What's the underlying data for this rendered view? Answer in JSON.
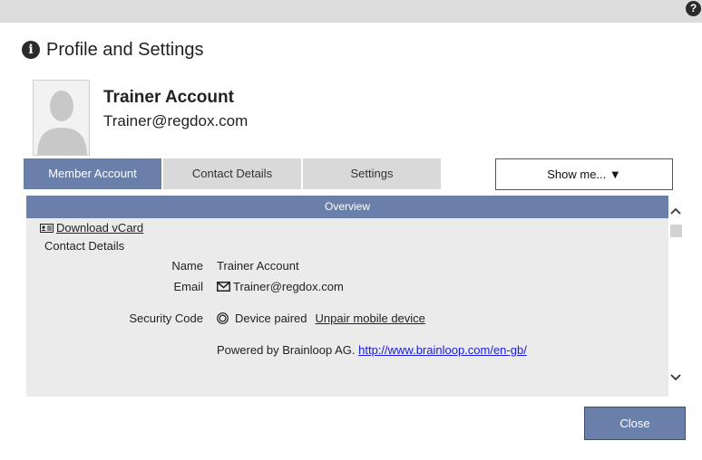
{
  "topbar": {
    "help_icon": "?"
  },
  "dialog": {
    "info_icon": "i",
    "title": "Profile and Settings",
    "account": {
      "name": "Trainer Account",
      "email": "Trainer@regdox.com"
    },
    "tabs": [
      {
        "label": "Member Account",
        "active": true
      },
      {
        "label": "Contact Details",
        "active": false
      },
      {
        "label": "Settings",
        "active": false
      }
    ],
    "show_me_label": "Show me... ▼",
    "panel": {
      "header": "Overview",
      "download_vcard": "Download vCard",
      "section_title": "Contact Details",
      "fields": [
        {
          "label": "Name",
          "value": "Trainer Account"
        },
        {
          "label": "Email",
          "value": "Trainer@regdox.com"
        },
        {
          "label": "Security Code",
          "value": "Device paired",
          "action": "Unpair mobile device"
        }
      ],
      "powered_by": "Powered by Brainloop AG.",
      "powered_link": "http://www.brainloop.com/en-gb/"
    },
    "close_label": "Close"
  },
  "colors": {
    "accent": "#6a80ab",
    "tab_inactive": "#d9d9d9",
    "panel_bg": "#ebebeb",
    "link": "#1a1ae0"
  },
  "icons": [
    "help-icon",
    "info-icon",
    "vcard-icon",
    "mail-icon",
    "device-paired-icon",
    "scroll-up-icon",
    "scroll-down-icon"
  ]
}
